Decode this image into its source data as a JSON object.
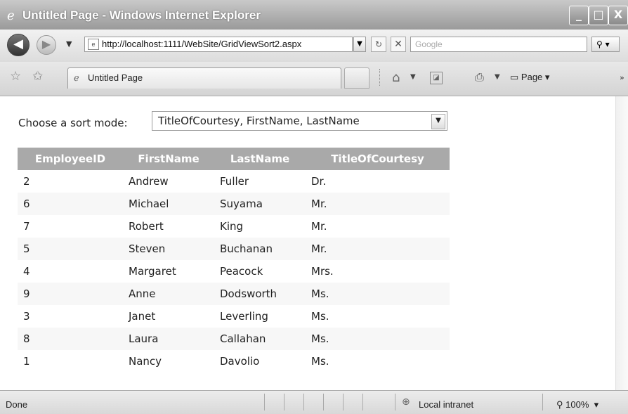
{
  "window": {
    "title": "Untitled Page - Windows Internet Explorer",
    "minimize": "_",
    "maximize": "□",
    "close": "X"
  },
  "address": {
    "url": "http://localhost:1111/WebSite/GridViewSort2.aspx",
    "search_placeholder": "Google"
  },
  "tab": {
    "label": "Untitled Page"
  },
  "toolbar": {
    "page_label": "Page"
  },
  "page": {
    "sort_label": "Choose a sort mode:",
    "sort_value": "TitleOfCourtesy, FirstName, LastName",
    "columns": [
      "EmployeeID",
      "FirstName",
      "LastName",
      "TitleOfCourtesy"
    ],
    "rows": [
      [
        "2",
        "Andrew",
        "Fuller",
        "Dr."
      ],
      [
        "6",
        "Michael",
        "Suyama",
        "Mr."
      ],
      [
        "7",
        "Robert",
        "King",
        "Mr."
      ],
      [
        "5",
        "Steven",
        "Buchanan",
        "Mr."
      ],
      [
        "4",
        "Margaret",
        "Peacock",
        "Mrs."
      ],
      [
        "9",
        "Anne",
        "Dodsworth",
        "Ms."
      ],
      [
        "3",
        "Janet",
        "Leverling",
        "Ms."
      ],
      [
        "8",
        "Laura",
        "Callahan",
        "Ms."
      ],
      [
        "1",
        "Nancy",
        "Davolio",
        "Ms."
      ]
    ]
  },
  "status": {
    "text": "Done",
    "zone": "Local intranet",
    "zoom": "100%"
  }
}
